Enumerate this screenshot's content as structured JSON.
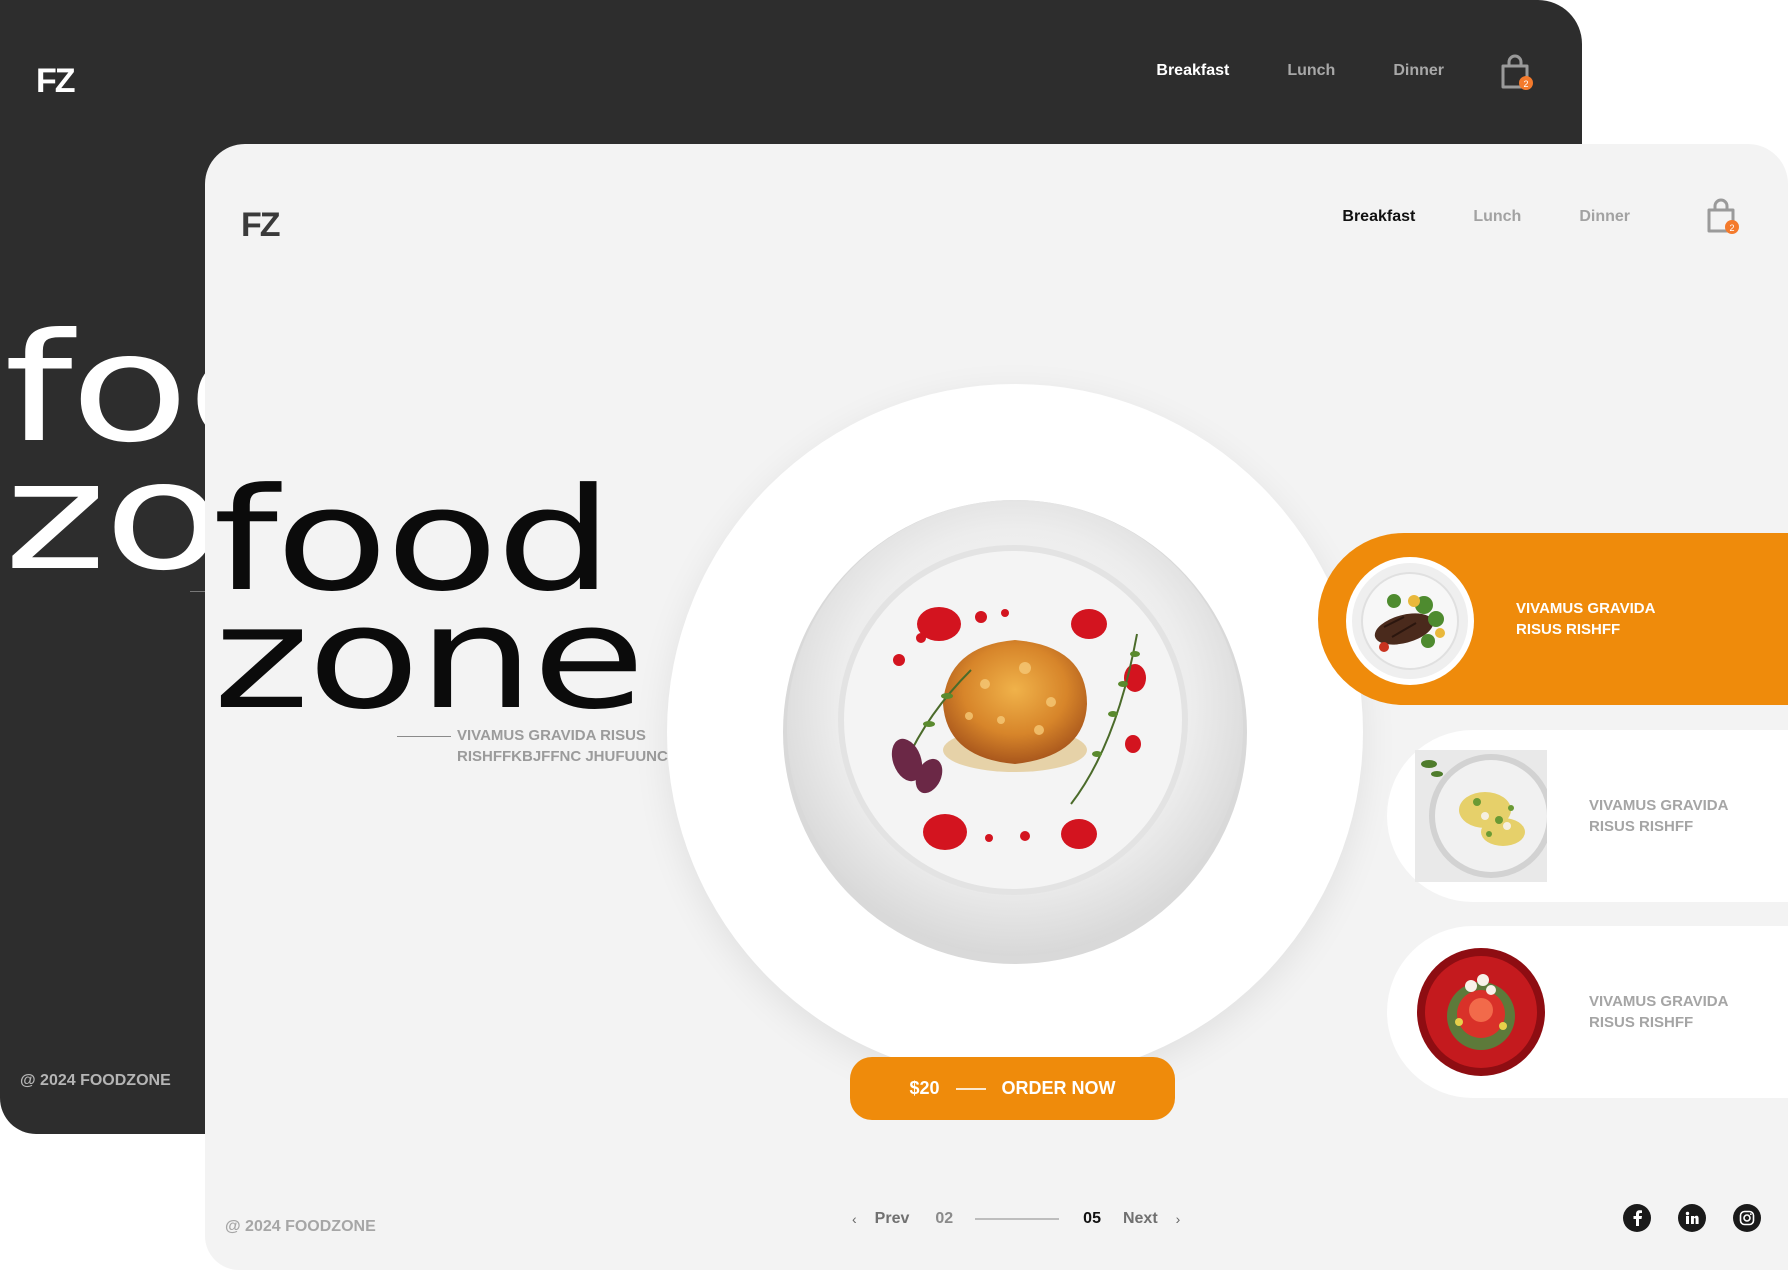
{
  "back_screen": {
    "logo": "FZ",
    "nav": [
      "Breakfast",
      "Lunch",
      "Dinner"
    ],
    "cart_count": "2",
    "hero_line1": "foo",
    "hero_line2": "zo",
    "copyright": "@ 2024 FOODZONE"
  },
  "front_screen": {
    "logo": "FZ",
    "nav": [
      "Breakfast",
      "Lunch",
      "Dinner"
    ],
    "cart_count": "2",
    "hero_line1": "food",
    "hero_line2": "zone",
    "hero_subtitle": "VIVAMUS GRAVIDA RISUS RISHFFKBJFFNC JHUFUUNC",
    "order": {
      "price": "$20",
      "label": "ORDER NOW"
    },
    "menu_items": [
      {
        "label": "VIVAMUS GRAVIDA RISUS RISHFF",
        "active": true,
        "image": "steak-salad-plate"
      },
      {
        "label": "VIVAMUS GRAVIDA RISUS RISHFF",
        "active": false,
        "image": "pasta-plate"
      },
      {
        "label": "VIVAMUS GRAVIDA RISUS RISHFF",
        "active": false,
        "image": "red-dessert-plate"
      }
    ],
    "copyright": "@ 2024 FOODZONE",
    "pager": {
      "prev": "Prev",
      "current": "02",
      "total": "05",
      "next": "Next"
    },
    "social": [
      "facebook-icon",
      "linkedin-icon",
      "instagram-icon"
    ]
  },
  "colors": {
    "accent": "#ef8b0b",
    "dark_bg": "#2d2d2d",
    "light_bg": "#f3f3f3",
    "badge": "#f47a2c"
  }
}
